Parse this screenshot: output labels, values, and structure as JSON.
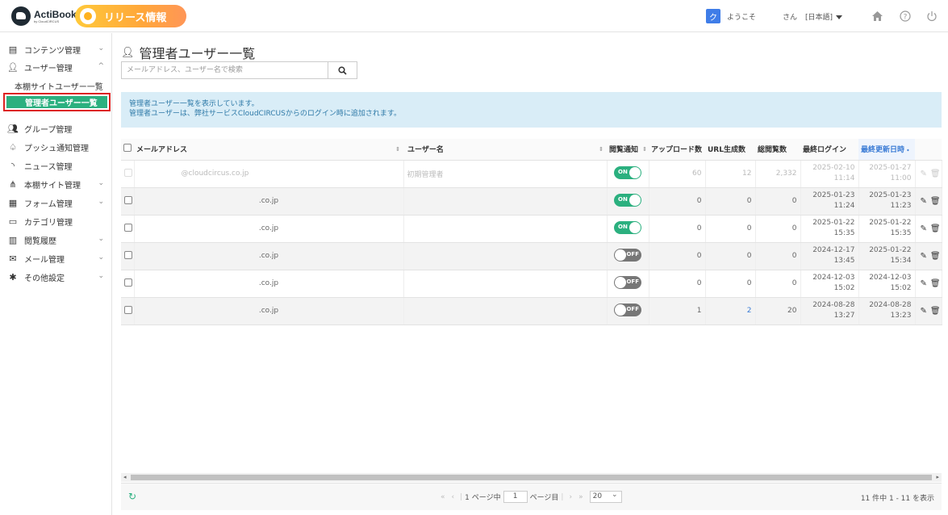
{
  "header": {
    "logo_text": "ActiBook",
    "logo_sub": "by CloudCIRCUS",
    "release_label": "リリース情報",
    "user_initial": "ク",
    "welcome": "ようこそ",
    "user_suffix": "さん",
    "language": "[日本語]",
    "icons": [
      "home-icon",
      "help-icon",
      "power-icon"
    ]
  },
  "sidebar": {
    "items": [
      {
        "label": "コンテンツ管理",
        "icon": "book-icon",
        "chevron": "⌄"
      },
      {
        "label": "ユーザー管理",
        "icon": "user-icon",
        "chevron": "^"
      },
      {
        "label": "グループ管理",
        "icon": "group-icon"
      },
      {
        "label": "プッシュ通知管理",
        "icon": "bell-icon"
      },
      {
        "label": "ニュース管理",
        "icon": "rss-icon"
      },
      {
        "label": "本棚サイト管理",
        "icon": "sitemap-icon",
        "chevron": "⌄"
      },
      {
        "label": "フォーム管理",
        "icon": "form-icon",
        "chevron": "⌄"
      },
      {
        "label": "カテゴリ管理",
        "icon": "folder-icon"
      },
      {
        "label": "閲覧履歴",
        "icon": "chart-icon",
        "chevron": "⌄"
      },
      {
        "label": "メール管理",
        "icon": "mail-icon",
        "chevron": "⌄"
      },
      {
        "label": "その他設定",
        "icon": "gear-icon",
        "chevron": "⌄"
      }
    ],
    "sub_items": [
      {
        "label": "本棚サイトユーザー一覧"
      },
      {
        "label": "管理者ユーザー一覧",
        "active": true
      }
    ]
  },
  "main": {
    "title": "管理者ユーザー一覧",
    "search_placeholder": "メールアドレス、ユーザー名で検索",
    "info_line1": "管理者ユーザー一覧を表示しています。",
    "info_line2": "管理者ユーザーは、弊社サービスCloudCIRCUSからのログイン時に追加されます。"
  },
  "table": {
    "headers": [
      "メールアドレス",
      "ユーザー名",
      "閲覧通知",
      "アップロード数",
      "URL生成数",
      "総閲覧数",
      "最終ログイン",
      "最終更新日時"
    ],
    "rows": [
      {
        "email": "@cloudcircus.co.jp",
        "name": "初期管理者",
        "notify": "ON",
        "uploads": "60",
        "urls": "12",
        "views": "2,332",
        "login_date": "2025-02-10",
        "login_time": "11:14",
        "upd_date": "2025-01-27",
        "upd_time": "11:00"
      },
      {
        "email": ".co.jp",
        "name": "",
        "notify": "ON",
        "uploads": "0",
        "urls": "0",
        "views": "0",
        "login_date": "2025-01-23",
        "login_time": "11:24",
        "upd_date": "2025-01-23",
        "upd_time": "11:23"
      },
      {
        "email": ".co.jp",
        "name": "",
        "notify": "ON",
        "uploads": "0",
        "urls": "0",
        "views": "0",
        "login_date": "2025-01-22",
        "login_time": "15:35",
        "upd_date": "2025-01-22",
        "upd_time": "15:35"
      },
      {
        "email": ".co.jp",
        "name": "",
        "notify": "OFF",
        "uploads": "0",
        "urls": "0",
        "views": "0",
        "login_date": "2024-12-17",
        "login_time": "13:45",
        "upd_date": "2025-01-22",
        "upd_time": "15:34"
      },
      {
        "email": ".co.jp",
        "name": "",
        "notify": "OFF",
        "uploads": "0",
        "urls": "0",
        "views": "0",
        "login_date": "2024-12-03",
        "login_time": "15:02",
        "upd_date": "2024-12-03",
        "upd_time": "15:02"
      },
      {
        "email": ".co.jp",
        "name": "",
        "notify": "OFF",
        "uploads": "1",
        "urls": "2",
        "views": "20",
        "login_date": "2024-08-28",
        "login_time": "13:27",
        "upd_date": "2024-08-28",
        "upd_time": "13:23"
      }
    ]
  },
  "footer": {
    "page_prefix": "1 ページ中",
    "page_value": "1",
    "page_suffix": "ページ目",
    "per_page": "20",
    "count_text": "11 件中 1 - 11 を表示"
  },
  "colors": {
    "accent_green": "#2bb07f",
    "link_blue": "#3a7bd5",
    "info_bg": "#d9edf7",
    "active_border": "#dd2222"
  }
}
